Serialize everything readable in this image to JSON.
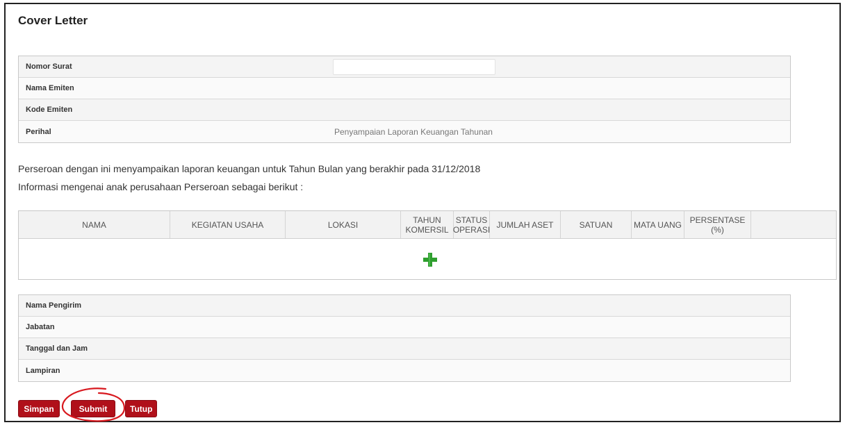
{
  "page": {
    "title": "Cover Letter"
  },
  "cover_info": {
    "rows": [
      {
        "label": "Nomor Surat",
        "value": ""
      },
      {
        "label": "Nama Emiten",
        "value": ""
      },
      {
        "label": "Kode Emiten",
        "value": ""
      },
      {
        "label": "Perihal",
        "value": "Penyampaian Laporan Keuangan Tahunan"
      }
    ]
  },
  "intro": {
    "line1": "Perseroan dengan ini menyampaikan laporan keuangan untuk Tahun Bulan yang berakhir pada 31/12/2018",
    "line2": "Informasi mengenai anak perusahaan Perseroan sebagai berikut :"
  },
  "subsidiary_table": {
    "columns": [
      "NAMA",
      "KEGIATAN USAHA",
      "LOKASI",
      "TAHUN KOMERSIL",
      "STATUS OPERASI",
      "JUMLAH ASET",
      "SATUAN",
      "MATA UANG",
      "PERSENTASE (%)"
    ],
    "rows": [],
    "add_icon": "plus-icon"
  },
  "sender_info": {
    "rows": [
      {
        "label": "Nama Pengirim",
        "value": ""
      },
      {
        "label": "Jabatan",
        "value": ""
      },
      {
        "label": "Tanggal dan Jam",
        "value": ""
      },
      {
        "label": "Lampiran",
        "value": ""
      }
    ]
  },
  "actions": {
    "simpan": "Simpan",
    "submit": "Submit",
    "tutup": "Tutup"
  },
  "colors": {
    "button_red": "#b0101a",
    "add_green": "#2e9e2e",
    "annotation_red": "#d8191f"
  }
}
